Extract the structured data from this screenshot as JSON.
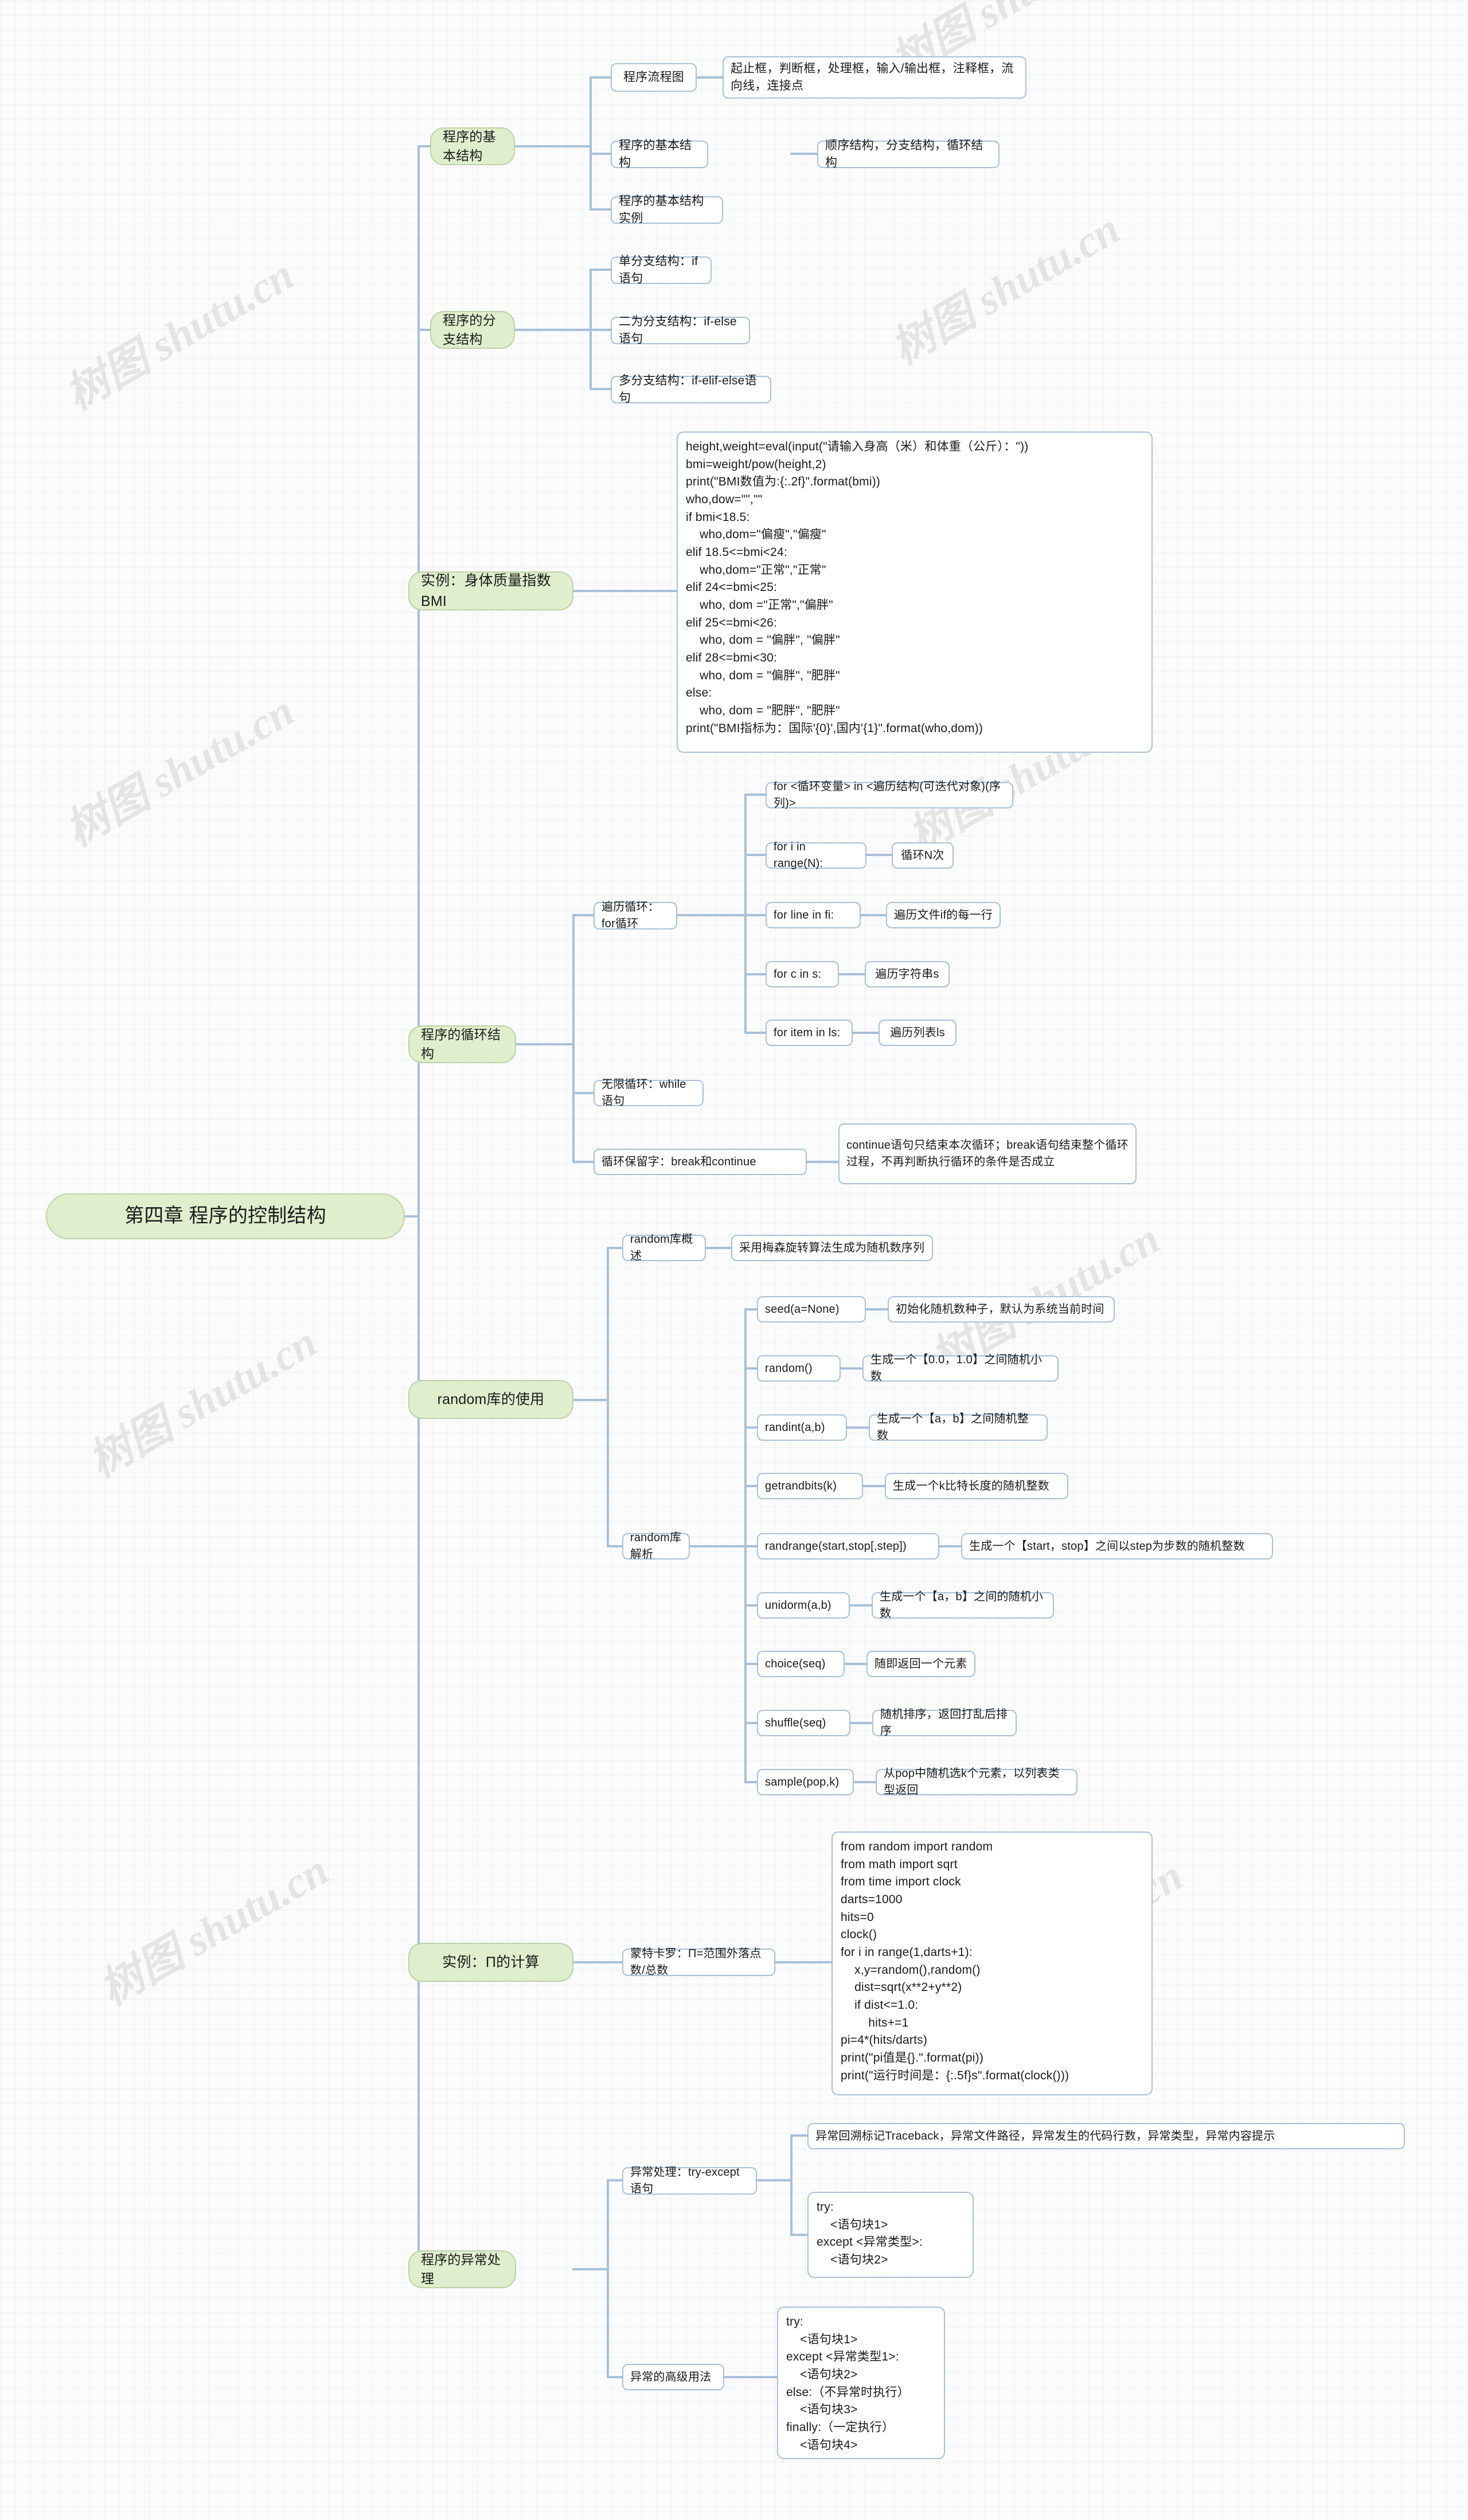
{
  "document": {
    "title": "第四章 程序的控制结构",
    "watermark_text": "树图 shutu.cn"
  },
  "colors": {
    "branch_fill": "#dfeecd",
    "branch_border": "#bcd3a8",
    "leaf_fill": "#ffffff",
    "leaf_border": "#a8c0d8",
    "link": "#a8c0d8",
    "text": "#1a1a1a",
    "background": "#fbfbfb"
  },
  "mindmap": {
    "root": "第四章 程序的控制结构",
    "branches": [
      {
        "label": "程序的基本结构",
        "children": [
          {
            "label": "程序流程图",
            "children": [
              {
                "label": "起止框，判断框，处理框，输入/输出框，注释框，流向线，连接点"
              }
            ]
          },
          {
            "label": "程序的基本结构",
            "children": [
              {
                "label": "顺序结构，分支结构，循环结构"
              }
            ]
          },
          {
            "label": "程序的基本结构实例",
            "children": []
          }
        ]
      },
      {
        "label": "程序的分支结构",
        "children": [
          {
            "label": "单分支结构：if语句",
            "children": []
          },
          {
            "label": "二为分支结构：if-else语句",
            "children": []
          },
          {
            "label": "多分支结构：if-elif-else语句",
            "children": []
          }
        ]
      },
      {
        "label": "实例：身体质量指数BMI",
        "children": [
          {
            "label": "height,weight=eval(input(\"请输入身高（米）和体重（公斤）：\"))\nbmi=weight/pow(height,2)\nprint(\"BMI数值为:{:.2f}\".format(bmi))\nwho,dow=\"\",\"\"\nif bmi<18.5:\n    who,dom=\"偏瘦\",\"偏瘦\"\nelif 18.5<=bmi<24:\n    who,dom=\"正常\",\"正常\"\nelif 24<=bmi<25:\n    who, dom =\"正常\",\"偏胖\"\nelif 25<=bmi<26:\n    who, dom = \"偏胖\", \"偏胖\"\nelif 28<=bmi<30:\n    who, dom = \"偏胖\", \"肥胖\"\nelse:\n    who, dom = \"肥胖\", \"肥胖\"\nprint(\"BMI指标为：国际'{0}',国内'{1}\".format(who,dom))",
            "children": []
          }
        ]
      },
      {
        "label": "程序的循环结构",
        "children": [
          {
            "label": "遍历循环：for循环",
            "children": [
              {
                "label": "for <循环变量> in <遍历结构(可迭代对象)(序列)>",
                "children": []
              },
              {
                "label": "for i in range(N):",
                "children": [
                  {
                    "label": "循环N次"
                  }
                ]
              },
              {
                "label": "for line in fi:",
                "children": [
                  {
                    "label": "遍历文件if的每一行"
                  }
                ]
              },
              {
                "label": "for c in s:",
                "children": [
                  {
                    "label": "遍历字符串s"
                  }
                ]
              },
              {
                "label": "for item in ls:",
                "children": [
                  {
                    "label": "遍历列表ls"
                  }
                ]
              }
            ]
          },
          {
            "label": "无限循环：while语句",
            "children": []
          },
          {
            "label": "循环保留字：break和continue",
            "children": [
              {
                "label": "continue语句只结束本次循环；break语句结束整个循环过程，不再判断执行循环的条件是否成立"
              }
            ]
          }
        ]
      },
      {
        "label": "random库的使用",
        "children": [
          {
            "label": "random库概述",
            "children": [
              {
                "label": "采用梅森旋转算法生成为随机数序列"
              }
            ]
          },
          {
            "label": "random库解析",
            "children": [
              {
                "label": "seed(a=None)",
                "children": [
                  {
                    "label": "初始化随机数种子，默认为系统当前时间"
                  }
                ]
              },
              {
                "label": "random()",
                "children": [
                  {
                    "label": "生成一个【0.0，1.0】之间随机小数"
                  }
                ]
              },
              {
                "label": "randint(a,b)",
                "children": [
                  {
                    "label": "生成一个【a，b】之间随机整数"
                  }
                ]
              },
              {
                "label": "getrandbits(k)",
                "children": [
                  {
                    "label": "生成一个k比特长度的随机整数"
                  }
                ]
              },
              {
                "label": "randrange(start,stop[,step])",
                "children": [
                  {
                    "label": "生成一个【start，stop】之间以step为步数的随机整数"
                  }
                ]
              },
              {
                "label": "unidorm(a,b)",
                "children": [
                  {
                    "label": "生成一个【a，b】之间的随机小数"
                  }
                ]
              },
              {
                "label": "choice(seq)",
                "children": [
                  {
                    "label": "随即返回一个元素"
                  }
                ]
              },
              {
                "label": "shuffle(seq)",
                "children": [
                  {
                    "label": "随机排序，返回打乱后排序"
                  }
                ]
              },
              {
                "label": "sample(pop,k)",
                "children": [
                  {
                    "label": "从pop中随机选k个元素，以列表类型返回"
                  }
                ]
              }
            ]
          }
        ]
      },
      {
        "label": "实例：Π的计算",
        "children": [
          {
            "label": "蒙特卡罗：Π=范围外落点数/总数",
            "children": [
              {
                "label": "from random import random\nfrom math import sqrt\nfrom time import clock\ndarts=1000\nhits=0\nclock()\nfor i in range(1,darts+1):\n    x,y=random(),random()\n    dist=sqrt(x**2+y**2)\n    if dist<=1.0:\n        hits+=1\npi=4*(hits/darts)\nprint(\"pi值是{}.\".format(pi))\nprint(\"运行时间是：{:.5f}s\".format(clock()))"
              }
            ]
          }
        ]
      },
      {
        "label": "程序的异常处理",
        "children": [
          {
            "label": "异常处理：try-except语句",
            "children": [
              {
                "label": "异常回溯标记Traceback，异常文件路径，异常发生的代码行数，异常类型，异常内容提示",
                "children": []
              },
              {
                "label": "try:\n    <语句块1>\nexcept <异常类型>:\n    <语句块2>",
                "children": []
              }
            ]
          },
          {
            "label": "异常的高级用法",
            "children": [
              {
                "label": "try:\n    <语句块1>\nexcept <异常类型1>:\n    <语句块2>\nelse:（不异常时执行）\n    <语句块3>\nfinally:（一定执行）\n    <语句块4>",
                "children": []
              }
            ]
          }
        ]
      }
    ]
  },
  "nodes": {
    "root": {
      "text": "第四章 程序的控制结构"
    },
    "b1": {
      "text": "程序的基本结构"
    },
    "b1c1": {
      "text": "程序流程图"
    },
    "b1c1d1": {
      "text": "起止框，判断框，处理框，输入/输出框，注释框，流向线，连接点"
    },
    "b1c2": {
      "text": "程序的基本结构"
    },
    "b1c2d1": {
      "text": "顺序结构，分支结构，循环结构"
    },
    "b1c3": {
      "text": "程序的基本结构实例"
    },
    "b2": {
      "text": "程序的分支结构"
    },
    "b2c1": {
      "text": "单分支结构：if语句"
    },
    "b2c2": {
      "text": "二为分支结构：if-else语句"
    },
    "b2c3": {
      "text": "多分支结构：if-elif-else语句"
    },
    "b3": {
      "text": "实例：身体质量指数BMI"
    },
    "b3code": {
      "text": "height,weight=eval(input(\"请输入身高（米）和体重（公斤）：\"))\nbmi=weight/pow(height,2)\nprint(\"BMI数值为:{:.2f}\".format(bmi))\nwho,dow=\"\",\"\"\nif bmi<18.5:\n    who,dom=\"偏瘦\",\"偏瘦\"\nelif 18.5<=bmi<24:\n    who,dom=\"正常\",\"正常\"\nelif 24<=bmi<25:\n    who, dom =\"正常\",\"偏胖\"\nelif 25<=bmi<26:\n    who, dom = \"偏胖\", \"偏胖\"\nelif 28<=bmi<30:\n    who, dom = \"偏胖\", \"肥胖\"\nelse:\n    who, dom = \"肥胖\", \"肥胖\"\nprint(\"BMI指标为：国际'{0}',国内'{1}\".format(who,dom))"
    },
    "b4": {
      "text": "程序的循环结构"
    },
    "b4c1": {
      "text": "遍历循环：for循环"
    },
    "b4c1d1": {
      "text": "for <循环变量> in <遍历结构(可迭代对象)(序列)>"
    },
    "b4c1d2": {
      "text": "for i in range(N):"
    },
    "b4c1d2e": {
      "text": "循环N次"
    },
    "b4c1d3": {
      "text": "for line in fi:"
    },
    "b4c1d3e": {
      "text": "遍历文件if的每一行"
    },
    "b4c1d4": {
      "text": "for c in s:"
    },
    "b4c1d4e": {
      "text": "遍历字符串s"
    },
    "b4c1d5": {
      "text": "for item in ls:"
    },
    "b4c1d5e": {
      "text": "遍历列表ls"
    },
    "b4c2": {
      "text": "无限循环：while语句"
    },
    "b4c3": {
      "text": "循环保留字：break和continue"
    },
    "b4c3d1": {
      "text": "continue语句只结束本次循环；break语句结束整个循环过程，不再判断执行循环的条件是否成立"
    },
    "b5": {
      "text": "random库的使用"
    },
    "b5c1": {
      "text": "random库概述"
    },
    "b5c1d1": {
      "text": "采用梅森旋转算法生成为随机数序列"
    },
    "b5c2": {
      "text": "random库解析"
    },
    "b5f1": {
      "text": "seed(a=None)"
    },
    "b5f1d": {
      "text": "初始化随机数种子，默认为系统当前时间"
    },
    "b5f2": {
      "text": "random()"
    },
    "b5f2d": {
      "text": "生成一个【0.0，1.0】之间随机小数"
    },
    "b5f3": {
      "text": "randint(a,b)"
    },
    "b5f3d": {
      "text": "生成一个【a，b】之间随机整数"
    },
    "b5f4": {
      "text": "getrandbits(k)"
    },
    "b5f4d": {
      "text": "生成一个k比特长度的随机整数"
    },
    "b5f5": {
      "text": "randrange(start,stop[,step])"
    },
    "b5f5d": {
      "text": "生成一个【start，stop】之间以step为步数的随机整数"
    },
    "b5f6": {
      "text": "unidorm(a,b)"
    },
    "b5f6d": {
      "text": "生成一个【a，b】之间的随机小数"
    },
    "b5f7": {
      "text": "choice(seq)"
    },
    "b5f7d": {
      "text": "随即返回一个元素"
    },
    "b5f8": {
      "text": "shuffle(seq)"
    },
    "b5f8d": {
      "text": "随机排序，返回打乱后排序"
    },
    "b5f9": {
      "text": "sample(pop,k)"
    },
    "b5f9d": {
      "text": "从pop中随机选k个元素，以列表类型返回"
    },
    "b6": {
      "text": "实例：Π的计算"
    },
    "b6c1": {
      "text": "蒙特卡罗：Π=范围外落点数/总数"
    },
    "b6code": {
      "text": "from random import random\nfrom math import sqrt\nfrom time import clock\ndarts=1000\nhits=0\nclock()\nfor i in range(1,darts+1):\n    x,y=random(),random()\n    dist=sqrt(x**2+y**2)\n    if dist<=1.0:\n        hits+=1\npi=4*(hits/darts)\nprint(\"pi值是{}.\".format(pi))\nprint(\"运行时间是：{:.5f}s\".format(clock()))"
    },
    "b7": {
      "text": "程序的异常处理"
    },
    "b7c1": {
      "text": "异常处理：try-except语句"
    },
    "b7c1d1": {
      "text": "异常回溯标记Traceback，异常文件路径，异常发生的代码行数，异常类型，异常内容提示"
    },
    "b7c1d2": {
      "text": "try:\n    <语句块1>\nexcept <异常类型>:\n    <语句块2>"
    },
    "b7c2": {
      "text": "异常的高级用法"
    },
    "b7c2d1": {
      "text": "try:\n    <语句块1>\nexcept <异常类型1>:\n    <语句块2>\nelse:（不异常时执行）\n    <语句块3>\nfinally:（一定执行）\n    <语句块4>"
    }
  }
}
